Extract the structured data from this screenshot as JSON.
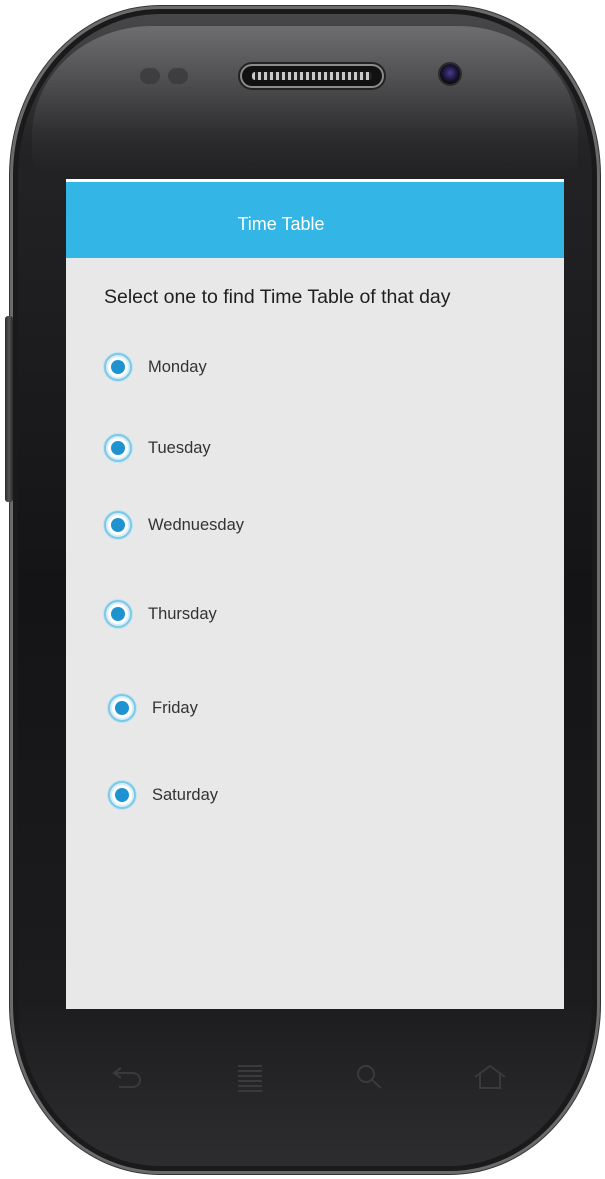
{
  "app": {
    "title": "Time Table"
  },
  "main": {
    "prompt": "Select one to find Time Table of that day",
    "options": [
      {
        "label": "Monday"
      },
      {
        "label": "Tuesday"
      },
      {
        "label": "Wednuesday"
      },
      {
        "label": "Thursday"
      },
      {
        "label": "Friday"
      },
      {
        "label": "Saturday"
      }
    ]
  },
  "device": {
    "nav_icons": [
      "back-icon",
      "menu-icon",
      "search-icon",
      "home-icon"
    ]
  },
  "colors": {
    "action_bar": "#33b5e5",
    "screen_background": "#e8e8e8",
    "radio_accent": "#1f93cf"
  }
}
